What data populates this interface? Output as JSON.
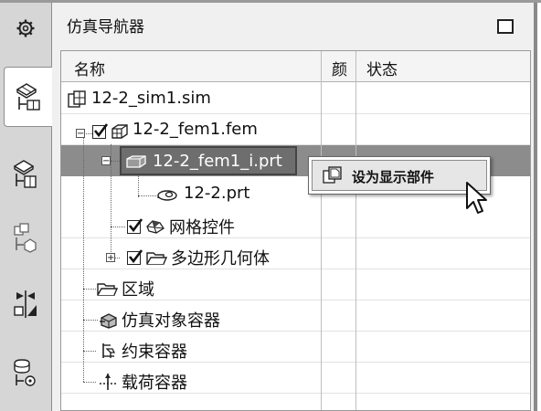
{
  "sidebar": {
    "items": [
      {
        "name": "gear-icon",
        "active": false
      },
      {
        "name": "simulation-navigator-icon",
        "active": true
      },
      {
        "name": "fem-navigator-icon",
        "active": false
      },
      {
        "name": "part-navigator-icon",
        "active": false
      },
      {
        "name": "mirror-icon",
        "active": false
      },
      {
        "name": "load-navigator-icon",
        "active": false
      }
    ]
  },
  "panel": {
    "title": "仿真导航器"
  },
  "table": {
    "columns": [
      "名称",
      "颜",
      "状态"
    ]
  },
  "tree": {
    "sim": "12-2_sim1.sim",
    "fem": "12-2_fem1.fem",
    "idealized": "12-2_fem1_i.prt",
    "prt": "12-2.prt",
    "mesh_controls": "网格控件",
    "polygon_geometry": "多边形几何体",
    "regions": "区域",
    "sim_object_container": "仿真对象容器",
    "constraint_container": "约束容器",
    "load_container": "载荷容器"
  },
  "context_menu": {
    "items": [
      {
        "label": "设为显示部件",
        "icon": "display-part-icon"
      }
    ]
  },
  "colors": {
    "selection": "#6e6e6e",
    "selection_row": "#8c8c8c",
    "sidebar": "#d6d6d6",
    "panel": "#f0f0f0"
  }
}
